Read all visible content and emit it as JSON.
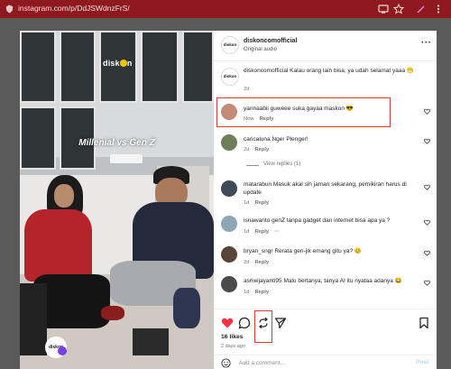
{
  "browser": {
    "url": "instagram.com/p/DdJSWdnzFrS/"
  },
  "video": {
    "brand_text": "disk",
    "brand_text_end": "n",
    "title_overlay": "Millenial vs Gen Z",
    "logo_text": "diskon"
  },
  "post": {
    "account": "diskoncomofficial",
    "audio": "Original audio",
    "caption": "diskoncomofficial Kalau orang lain bisa, ya udah selamat yaaa 😁",
    "caption_time": "2d",
    "likes": "16 likes",
    "date": "2 days ago"
  },
  "comments": [
    {
      "user": "yannaabii",
      "text": "guweee suka gayaa maskon 😎",
      "time": "Now",
      "reply": "Reply"
    },
    {
      "user": "caricaluna",
      "text": "Nger Plenger!",
      "time": "2d",
      "reply": "Reply"
    },
    {
      "user": "matarabun",
      "text": "Masuk akal sih jaman sekarang, pemikiran harus di update",
      "time": "1d",
      "reply": "Reply"
    },
    {
      "user": "isnawanto",
      "text": "genZ tanpa gadget dan internet bisa apa ya ?",
      "time": "1d",
      "reply": "Reply"
    },
    {
      "user": "bryan_sngr",
      "text": "Rerata gen-jik emang gitu ya? 😊",
      "time": "2d",
      "reply": "Reply"
    },
    {
      "user": "asriwijayanti95",
      "text": "Malu bertanya, tanya AI itu nyataa adanya 😂",
      "time": "1d",
      "reply": "Reply"
    }
  ],
  "view_replies": "View replies (1)",
  "more_menu": "···",
  "comment_box": {
    "placeholder": "Add a comment...",
    "post_label": "Post"
  },
  "colors": {
    "browser_bar": "#8e1a1f",
    "highlight": "#d83a3a",
    "like_red": "#ff3040",
    "post_button": "#b3dbff"
  }
}
